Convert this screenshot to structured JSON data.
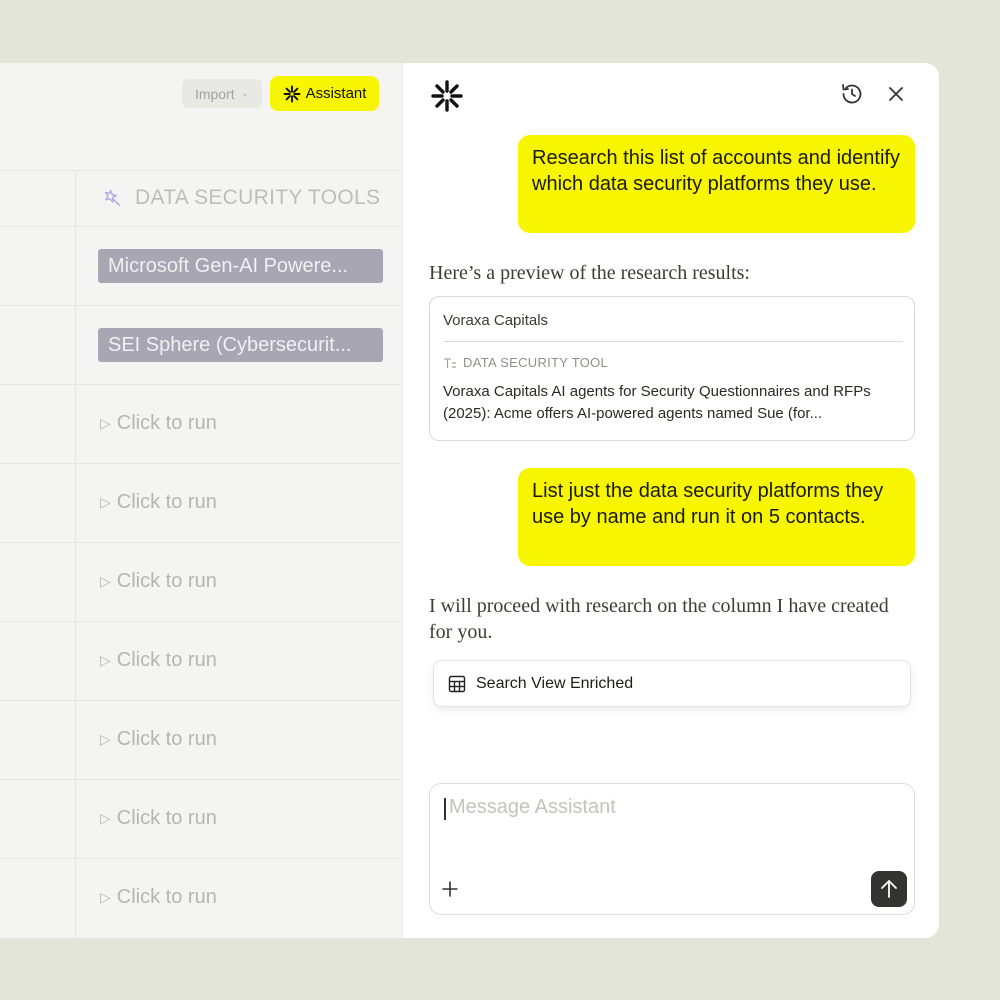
{
  "toolbar": {
    "import_label": "Import",
    "assistant_label": "Assistant"
  },
  "table": {
    "column_header": "DATA SECURITY TOOLS",
    "rows": [
      {
        "type": "value",
        "text": "Microsoft Gen-AI Powere..."
      },
      {
        "type": "value",
        "text": "SEI Sphere (Cybersecurit..."
      },
      {
        "type": "action",
        "text": "Click to run"
      },
      {
        "type": "action",
        "text": "Click to run"
      },
      {
        "type": "action",
        "text": "Click to run"
      },
      {
        "type": "action",
        "text": "Click to run"
      },
      {
        "type": "action",
        "text": "Click to run"
      },
      {
        "type": "action",
        "text": "Click to run"
      },
      {
        "type": "action",
        "text": "Click to run"
      }
    ]
  },
  "chat": {
    "messages": [
      {
        "role": "user",
        "text": "Research this list of accounts and identify which data security platforms they use."
      },
      {
        "role": "assistant",
        "text": "Here’s a preview of the research results:"
      },
      {
        "role": "user",
        "text": "List just the data security platforms they use by name and run it on 5 contacts."
      },
      {
        "role": "assistant",
        "text": "I will proceed with research on the column I have created for you."
      }
    ],
    "preview_card": {
      "company": "Voraxa Capitals",
      "field_label": "DATA SECURITY TOOL",
      "body": "Voraxa Capitals AI agents for Security Questionnaires and RFPs (2025): Acme offers AI-powered agents named Sue (for..."
    },
    "view_button_label": "Search View Enriched",
    "composer_placeholder": "Message Assistant"
  },
  "colors": {
    "accent_yellow": "#f7f600",
    "chip": "#a8a6b2",
    "background": "#e4e5d9"
  },
  "icons": {
    "assistant": "sparkle-asterisk-icon",
    "history": "history-icon",
    "close": "close-icon",
    "table": "table-icon",
    "plus": "plus-icon",
    "send": "arrow-up-icon"
  }
}
